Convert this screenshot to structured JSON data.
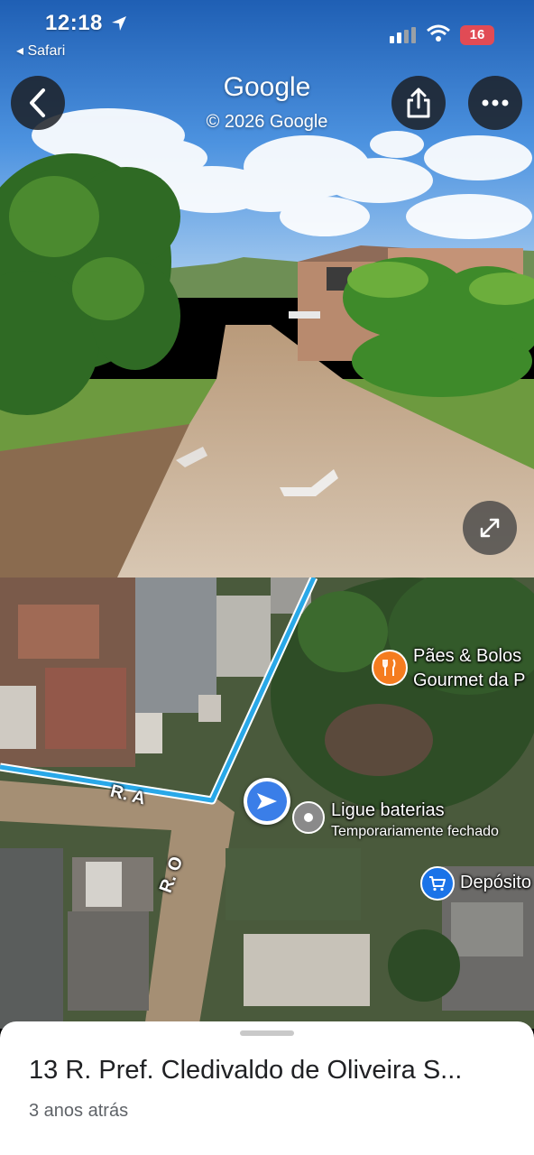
{
  "status_bar": {
    "time": "12:18",
    "back_app": "◂ Safari",
    "battery": "16"
  },
  "viewer": {
    "title": "Google",
    "copyright": "© 2026 Google"
  },
  "map": {
    "pois": [
      {
        "name": "Pães & Bolos",
        "name2": "Gourmet da P",
        "icon": "restaurant-icon",
        "color": "#f57c1f"
      },
      {
        "name": "Ligue baterias",
        "subtitle": "Temporariamente fechado",
        "icon": "place-icon",
        "color": "#8a8a8a"
      },
      {
        "name": "Depósito",
        "icon": "shopping-cart-icon",
        "color": "#1a73e8"
      }
    ],
    "streets": [
      "R. A",
      "R. O"
    ]
  },
  "sheet": {
    "address": "13 R. Pref. Cledivaldo de Oliveira S...",
    "age": "3 anos atrás"
  }
}
